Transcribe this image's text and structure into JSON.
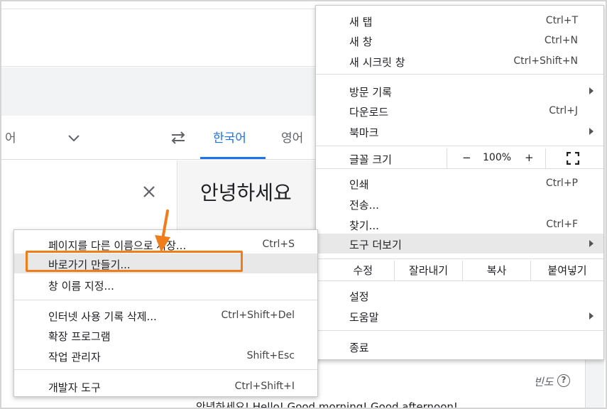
{
  "background": {
    "source_lang_partial": "어",
    "target_lang": "한국어",
    "other_lang": "영어",
    "translated_text": "안녕하세요",
    "frequency_label": "빈도",
    "help_glyph": "?",
    "bottom_cut_text": "안녕하세요! Hello! Good morning! Good afternoon!"
  },
  "menu": {
    "new_tab": {
      "label": "새 탭",
      "shortcut": "Ctrl+T"
    },
    "new_window": {
      "label": "새 창",
      "shortcut": "Ctrl+N"
    },
    "incognito": {
      "label": "새 시크릿 창",
      "shortcut": "Ctrl+Shift+N"
    },
    "history": {
      "label": "방문 기록"
    },
    "downloads": {
      "label": "다운로드",
      "shortcut": "Ctrl+J"
    },
    "bookmarks": {
      "label": "북마크"
    },
    "zoom": {
      "label": "글꼴 크기",
      "minus": "−",
      "value": "100%",
      "plus": "+"
    },
    "print": {
      "label": "인쇄",
      "shortcut": "Ctrl+P"
    },
    "cast": {
      "label": "전송..."
    },
    "find": {
      "label": "찾기...",
      "shortcut": "Ctrl+F"
    },
    "more_tools": {
      "label": "도구 더보기"
    },
    "edit": {
      "label": "수정",
      "cut": "잘라내기",
      "copy": "복사",
      "paste": "붙여넣기"
    },
    "settings": {
      "label": "설정"
    },
    "help": {
      "label": "도움말"
    },
    "exit": {
      "label": "종료"
    }
  },
  "submenu": {
    "save_page": {
      "label": "페이지를 다른 이름으로 저장...",
      "shortcut": "Ctrl+S"
    },
    "create_shortcut": {
      "label": "바로가기 만들기..."
    },
    "name_window": {
      "label": "창 이름 지정..."
    },
    "clear_data": {
      "label": "인터넷 사용 기록 삭제...",
      "shortcut": "Ctrl+Shift+Del"
    },
    "extensions": {
      "label": "확장 프로그램"
    },
    "task_manager": {
      "label": "작업 관리자",
      "shortcut": "Shift+Esc"
    },
    "dev_tools": {
      "label": "개발자 도구",
      "shortcut": "Ctrl+Shift+I"
    }
  },
  "colors": {
    "accent_blue": "#1a73e8",
    "highlight_orange": "#f07c1a",
    "menu_hover": "#e8e8e8"
  }
}
